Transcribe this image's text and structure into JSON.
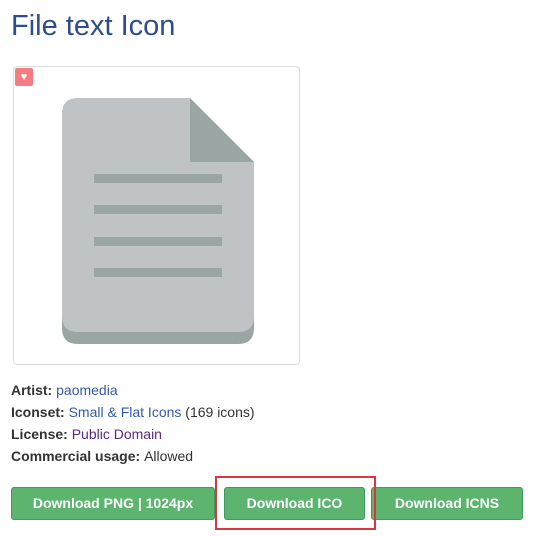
{
  "page": {
    "title": "File text Icon"
  },
  "preview": {
    "favorite_icon": "heart-icon",
    "favorite_symbol": "♥",
    "icon_name": "file-text-icon",
    "colors": {
      "page": "#bfc3c6",
      "fold": "#9aa6a4",
      "shadow": "#9aa6a4",
      "lines": "#9aa6a4",
      "badge": "#f37d83"
    }
  },
  "meta": {
    "artist_label": "Artist:",
    "artist_value": "paomedia",
    "iconset_label": "Iconset:",
    "iconset_value": "Small & Flat Icons",
    "iconset_count": "(169 icons)",
    "license_label": "License:",
    "license_value": "Public Domain",
    "commercial_label": "Commercial usage:",
    "commercial_value": "Allowed"
  },
  "downloads": {
    "png_label": "Download PNG | 1024px",
    "ico_label": "Download ICO",
    "icns_label": "Download ICNS",
    "button_color": "#5cb46e",
    "highlight_color": "#d9363e"
  }
}
